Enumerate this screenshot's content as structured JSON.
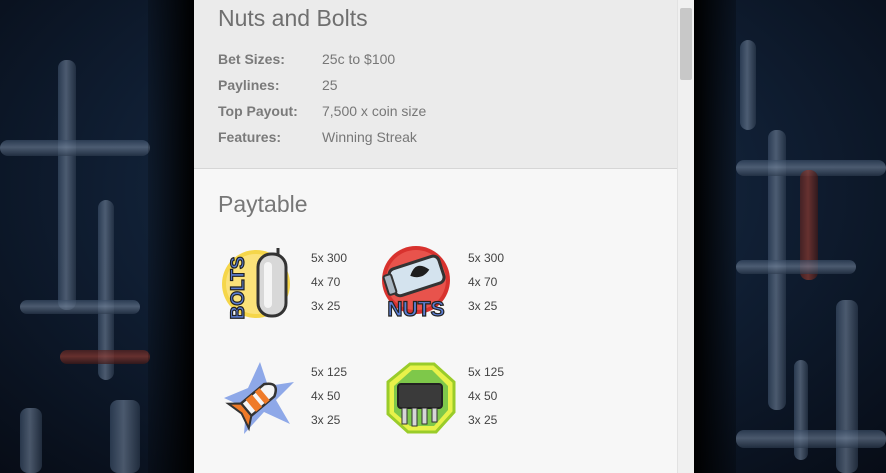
{
  "game": {
    "title": "Nuts and Bolts",
    "details": [
      {
        "label": "Bet Sizes:",
        "value": "25c to $100"
      },
      {
        "label": "Paylines:",
        "value": "25"
      },
      {
        "label": "Top Payout:",
        "value": "7,500 x coin size"
      },
      {
        "label": "Features:",
        "value": "Winning Streak"
      }
    ]
  },
  "paytable": {
    "title": "Paytable",
    "symbols": [
      {
        "name": "bolts-symbol",
        "icon": "bolts-icon",
        "pays": [
          "5x 300",
          "4x 70",
          "3x 25"
        ]
      },
      {
        "name": "nuts-symbol",
        "icon": "nuts-icon",
        "pays": [
          "5x 300",
          "4x 70",
          "3x 25"
        ]
      },
      {
        "name": "rocket-symbol",
        "icon": "rocket-icon",
        "pays": [
          "5x 125",
          "4x 50",
          "3x 25"
        ]
      },
      {
        "name": "chip-symbol",
        "icon": "chip-icon",
        "pays": [
          "5x 125",
          "4x 50",
          "3x 25"
        ]
      }
    ]
  },
  "colors": {
    "panel_bg": "#f7f7f7",
    "info_bg": "#ebebeb",
    "title_text": "#6f6f6f"
  }
}
